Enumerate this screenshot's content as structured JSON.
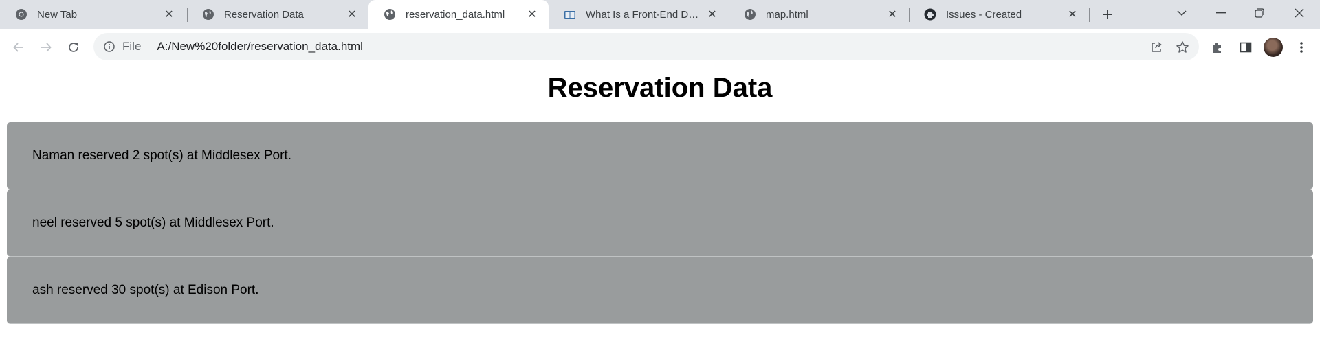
{
  "browser": {
    "tabs": [
      {
        "title": "New Tab",
        "icon": "chrome-icon",
        "active": false
      },
      {
        "title": "Reservation Data",
        "icon": "globe-icon",
        "active": false
      },
      {
        "title": "reservation_data.html",
        "icon": "globe-icon",
        "active": true
      },
      {
        "title": "What Is a Front-End Develo",
        "icon": "book-icon",
        "active": false
      },
      {
        "title": "map.html",
        "icon": "globe-icon",
        "active": false
      },
      {
        "title": "Issues - Created",
        "icon": "github-icon",
        "active": false
      }
    ],
    "address": {
      "scheme_label": "File",
      "url": "A:/New%20folder/reservation_data.html"
    }
  },
  "page": {
    "title": "Reservation Data",
    "reservations": [
      {
        "text": "Naman reserved 2 spot(s) at Middlesex Port."
      },
      {
        "text": "neel reserved 5 spot(s) at Middlesex Port."
      },
      {
        "text": "ash reserved 30 spot(s) at Edison Port."
      }
    ]
  },
  "colors": {
    "tabstrip_bg": "#dee1e6",
    "card_bg": "#999c9d"
  }
}
